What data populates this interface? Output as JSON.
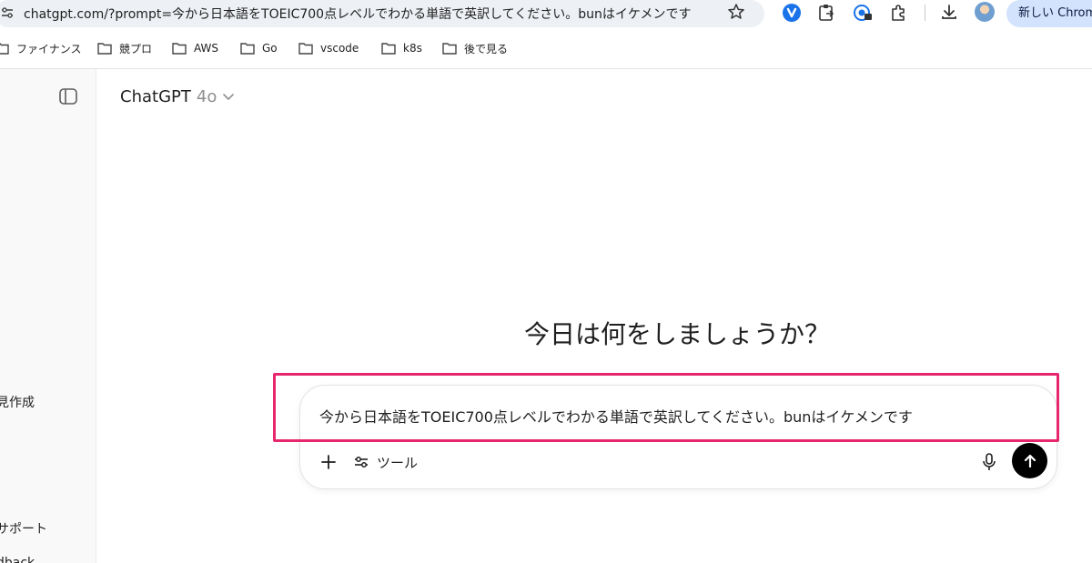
{
  "browser": {
    "url": "chatgpt.com/?prompt=今から日本語をTOEIC700点レベルでわかる単語で英訳してください。bunはイケメンです",
    "new_chrome_label": "新しい Chrome"
  },
  "bookmarks": [
    {
      "label": "ファイナンス"
    },
    {
      "label": "競プロ"
    },
    {
      "label": "AWS"
    },
    {
      "label": "Go"
    },
    {
      "label": "vscode"
    },
    {
      "label": "k8s"
    },
    {
      "label": "後で見る"
    }
  ],
  "sidebar": {
    "items": [
      {
        "label": "見作成"
      },
      {
        "label": "サポート"
      },
      {
        "label": "dback"
      }
    ]
  },
  "header": {
    "model_name": "ChatGPT",
    "model_version": "4o"
  },
  "main": {
    "greeting": "今日は何をしましょうか？"
  },
  "composer": {
    "prompt_text": "今から日本語をTOEIC700点レベルでわかる単語で英訳してください。bunはイケメンです",
    "tools_label": "ツール"
  },
  "colors": {
    "highlight": "#e6276e",
    "send_button": "#000000",
    "sidebar_bg": "#f9f9f9"
  }
}
